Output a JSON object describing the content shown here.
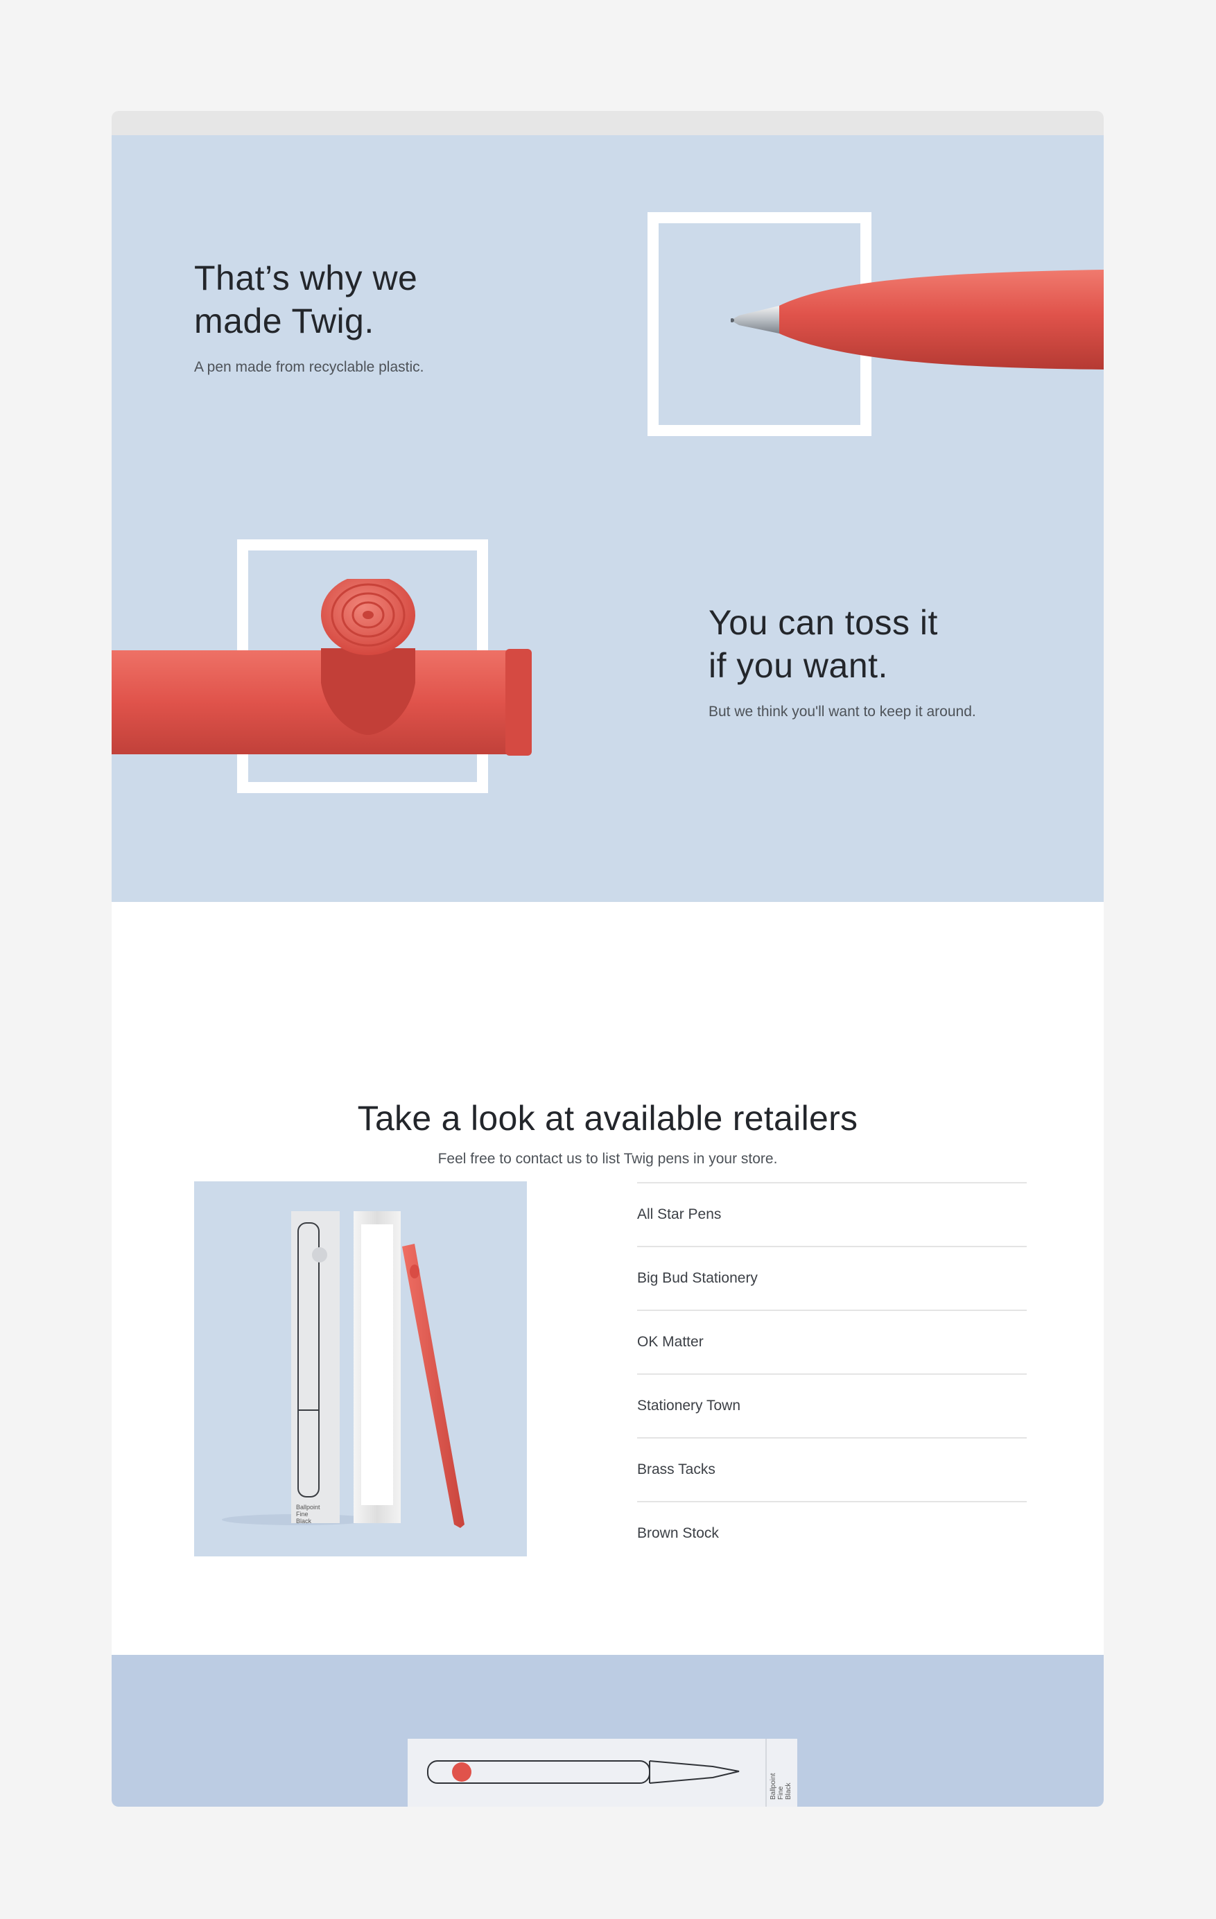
{
  "hero": {
    "block1": {
      "title_line1": "That’s why we",
      "title_line2": "made Twig.",
      "subtitle": "A pen made from recyclable plastic."
    },
    "block2": {
      "title_line1": "You can toss it",
      "title_line2": "if you want.",
      "subtitle": "But we think you'll want to keep it around."
    }
  },
  "retailers": {
    "title": "Take a look at available retailers",
    "subtitle": "Feel free to contact us to list Twig pens in your store.",
    "items": [
      "All Star Pens",
      "Big Bud Stationery",
      "OK Matter",
      "Stationery Town",
      "Brass Tacks",
      "Brown Stock"
    ],
    "product_label": {
      "line1": "Ballpoint",
      "line2": "Fine",
      "line3": "Black"
    }
  },
  "footer": {
    "box_label": {
      "line1": "Ballpoint",
      "line2": "Fine",
      "line3": "Black"
    }
  },
  "colors": {
    "page_bg": "#f4f4f4",
    "hero_bg": "#ccdaea",
    "footer_bg": "#bccce3",
    "pen_red": "#e0534b",
    "text_dark": "#23262b"
  }
}
